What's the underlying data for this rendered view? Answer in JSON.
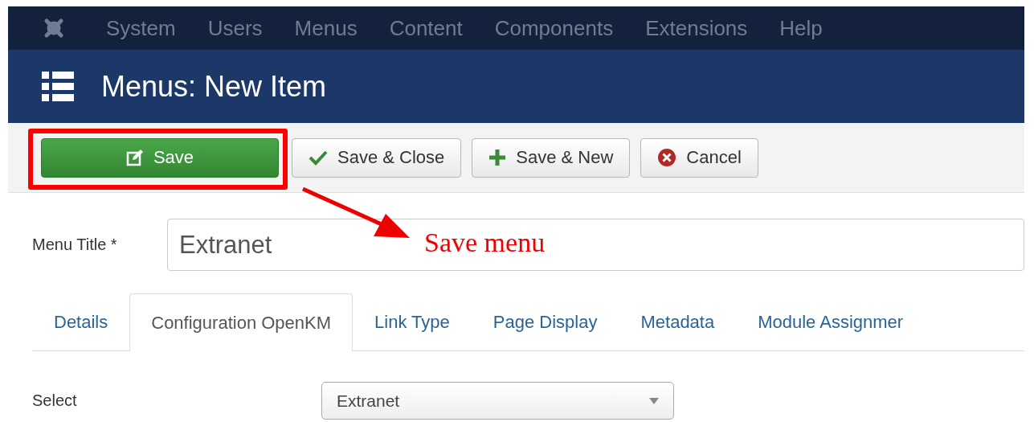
{
  "navbar": {
    "items": [
      "System",
      "Users",
      "Menus",
      "Content",
      "Components",
      "Extensions",
      "Help"
    ]
  },
  "header": {
    "title": "Menus: New Item"
  },
  "toolbar": {
    "buttons": [
      {
        "label": "Save",
        "kind": "save"
      },
      {
        "label": "Save & Close",
        "kind": "save-close"
      },
      {
        "label": "Save & New",
        "kind": "save-new"
      },
      {
        "label": "Cancel",
        "kind": "cancel"
      }
    ]
  },
  "annotation": {
    "text": "Save menu"
  },
  "form": {
    "menu_title": {
      "label": "Menu Title *",
      "value": "Extranet"
    },
    "tabs": [
      {
        "label": "Details",
        "selected": false
      },
      {
        "label": "Configuration OpenKM",
        "selected": true
      },
      {
        "label": "Link Type",
        "selected": false
      },
      {
        "label": "Page Display",
        "selected": false
      },
      {
        "label": "Metadata",
        "selected": false
      },
      {
        "label": "Module Assignmer",
        "selected": false
      }
    ],
    "select": {
      "label": "Select",
      "value": "Extranet"
    }
  }
}
